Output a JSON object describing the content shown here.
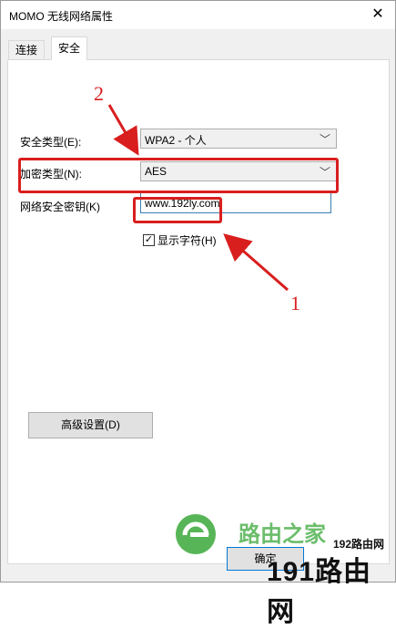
{
  "window": {
    "title": "MOMO 无线网络属性",
    "close_glyph": "✕"
  },
  "tabs": [
    {
      "label": "连接"
    },
    {
      "label": "安全"
    }
  ],
  "form": {
    "security_type_label": "安全类型(E):",
    "security_type_value": "WPA2 - 个人",
    "encryption_type_label": "加密类型(N):",
    "encryption_type_value": "AES",
    "key_label": "网络安全密钥(K)",
    "key_value": "www.192ly.com",
    "show_chars_label": "显示字符(H)",
    "show_chars_checked": true,
    "dropdown_glyph": "﹀"
  },
  "buttons": {
    "advanced": "高级设置(D)",
    "ok": "确定"
  },
  "annotations": {
    "one": "1",
    "two": "2",
    "color": "#d91e1e"
  },
  "watermark": {
    "brand": "路由之家",
    "site_small": "192路由网",
    "site_large": "191路由网"
  }
}
